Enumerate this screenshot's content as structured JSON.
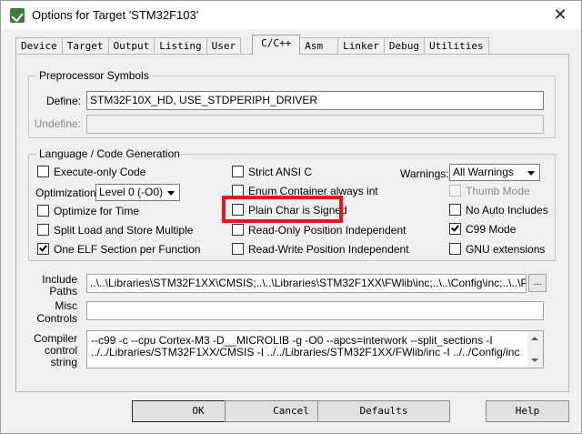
{
  "window": {
    "title": "Options for Target 'STM32F103'",
    "close_glyph": "✕"
  },
  "tabs": [
    {
      "label": "Device"
    },
    {
      "label": "Target"
    },
    {
      "label": "Output"
    },
    {
      "label": "Listing"
    },
    {
      "label": "User"
    },
    {
      "label": "C/C++",
      "active": true
    },
    {
      "label": "Asm"
    },
    {
      "label": "Linker"
    },
    {
      "label": "Debug"
    },
    {
      "label": "Utilities"
    }
  ],
  "preprocessor": {
    "title": "Preprocessor Symbols",
    "define_label": "Define:",
    "define_value": "STM32F10X_HD, USE_STDPERIPH_DRIVER",
    "undefine_label": "Undefine:",
    "undefine_value": ""
  },
  "language": {
    "title": "Language / Code Generation",
    "execute_only": {
      "label": "Execute-only Code",
      "checked": false
    },
    "optimization_label": "Optimization:",
    "optimization_value": "Level 0 (-O0)",
    "optimize_time": {
      "label": "Optimize for Time",
      "checked": false
    },
    "split_load": {
      "label": "Split Load and Store Multiple",
      "checked": false
    },
    "one_elf": {
      "label": "One ELF Section per Function",
      "checked": true
    },
    "strict_ansi": {
      "label": "Strict ANSI C",
      "checked": false
    },
    "enum_container": {
      "label": "Enum Container always int",
      "checked": false
    },
    "plain_char": {
      "label": "Plain Char is Signed",
      "checked": false
    },
    "ro_position": {
      "label": "Read-Only Position Independent",
      "checked": false
    },
    "rw_position": {
      "label": "Read-Write Position Independent",
      "checked": false
    },
    "warnings_label": "Warnings:",
    "warnings_value": "All Warnings",
    "thumb_mode": {
      "label": "Thumb Mode",
      "checked": false,
      "disabled": true
    },
    "no_auto_includes": {
      "label": "No Auto Includes",
      "checked": false
    },
    "c99_mode": {
      "label": "C99 Mode",
      "checked": true
    },
    "gnu_ext": {
      "label": "GNU extensions",
      "checked": false
    }
  },
  "include_paths": {
    "label_line1": "Include",
    "label_line2": "Paths",
    "value": "..\\..\\Libraries\\STM32F1XX\\CMSIS;..\\..\\Libraries\\STM32F1XX\\FWlib\\inc;..\\..\\Config\\inc;..\\..\\Periphe",
    "browse_label": "..."
  },
  "misc_controls": {
    "label_line1": "Misc",
    "label_line2": "Controls",
    "value": ""
  },
  "compiler_string": {
    "label_line1": "Compiler",
    "label_line2": "control",
    "label_line3": "string",
    "line1": "--c99 -c --cpu Cortex-M3 -D__MICROLIB -g -O0 --apcs=interwork --split_sections -I",
    "line2": "../../Libraries/STM32F1XX/CMSIS -I ../../Libraries/STM32F1XX/FWlib/inc -I ../../Config/inc -I"
  },
  "buttons": {
    "ok": "OK",
    "cancel": "Cancel",
    "defaults": "Defaults",
    "help": "Help"
  },
  "colors": {
    "highlight": "#e8161a",
    "dialog_bg": "#f0f0f0"
  }
}
